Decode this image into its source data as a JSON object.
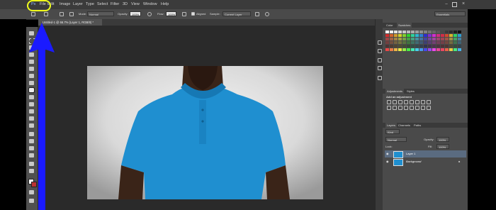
{
  "menubar": {
    "app_icon": "Ps",
    "items": [
      "File",
      "Edit",
      "Image",
      "Layer",
      "Type",
      "Select",
      "Filter",
      "3D",
      "View",
      "Window",
      "Help"
    ]
  },
  "options": {
    "mode_label": "Mode:",
    "mode_value": "Normal",
    "opacity_label": "Opacity:",
    "opacity_value": "100%",
    "flow_label": "Flow:",
    "flow_value": "100%",
    "aligned_label": "Aligned",
    "sample_label": "Sample:",
    "sample_value": "Current Layer",
    "workspace_value": "Essentials"
  },
  "document": {
    "tab_title": "Untitled-1 @ 66.7% (Layer 1, RGB/8) *"
  },
  "panels": {
    "color_tab": "Color",
    "swatches_tab": "Swatches",
    "adjustments_tab": "Adjustments",
    "styles_tab": "Styles",
    "adjustments_hint": "Add an adjustment",
    "layers_tab": "Layers",
    "channels_tab": "Channels",
    "paths_tab": "Paths",
    "kind_filter": "Kind",
    "blend_mode": "Normal",
    "opacity_label": "Opacity:",
    "opacity_value": "100%",
    "lock_label": "Lock:",
    "fill_label": "Fill:",
    "fill_value": "100%",
    "layers": [
      {
        "name": "Layer 1",
        "selected": true
      },
      {
        "name": "Background",
        "selected": false
      }
    ]
  },
  "colors": {
    "callout": "#f0ff1c",
    "arrow": "#1a1aff",
    "shirt": "#1f8fd0",
    "selected_layer": "#5a6b80"
  }
}
